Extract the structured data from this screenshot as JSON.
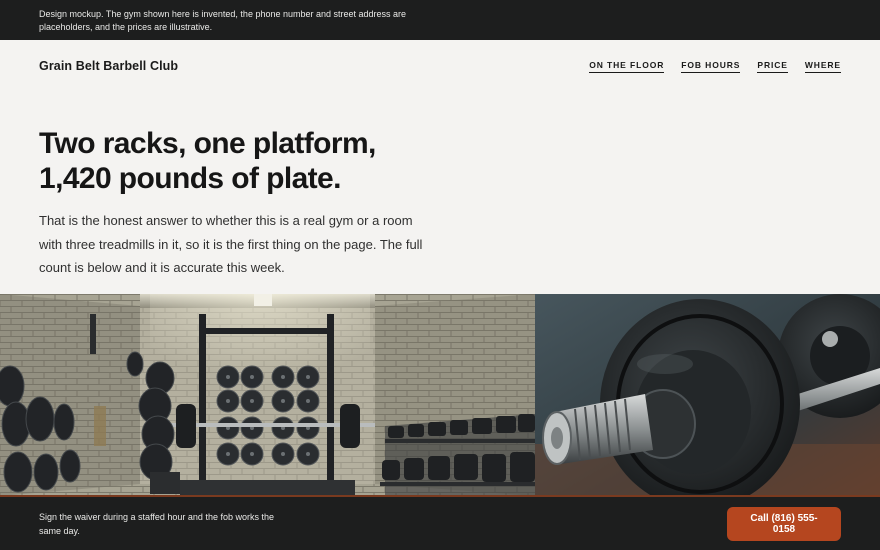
{
  "disclaimer": "Design mockup. The gym shown here is invented, the phone number and street address are placeholders, and the prices are illustrative.",
  "header": {
    "brand": "Grain Belt Barbell Club",
    "nav": [
      {
        "label": "ON THE FLOOR"
      },
      {
        "label": "FOB HOURS"
      },
      {
        "label": "PRICE"
      },
      {
        "label": "WHERE"
      }
    ]
  },
  "hero": {
    "title": "Two racks, one platform, 1,420 pounds of plate.",
    "body": "That is the honest answer to whether this is a real gym or a room with three treadmills in it, so it is the first thing on the page. The full count is below and it is accurate this week."
  },
  "footer_bar": {
    "note": "Sign the waiver during a staffed hour and the fob works the same day.",
    "cta_label": "Call (816) 555-0158"
  },
  "colors": {
    "dark_bar": "#1d1e1e",
    "accent": "#b5461f",
    "page_bg": "#f4f3f1"
  }
}
